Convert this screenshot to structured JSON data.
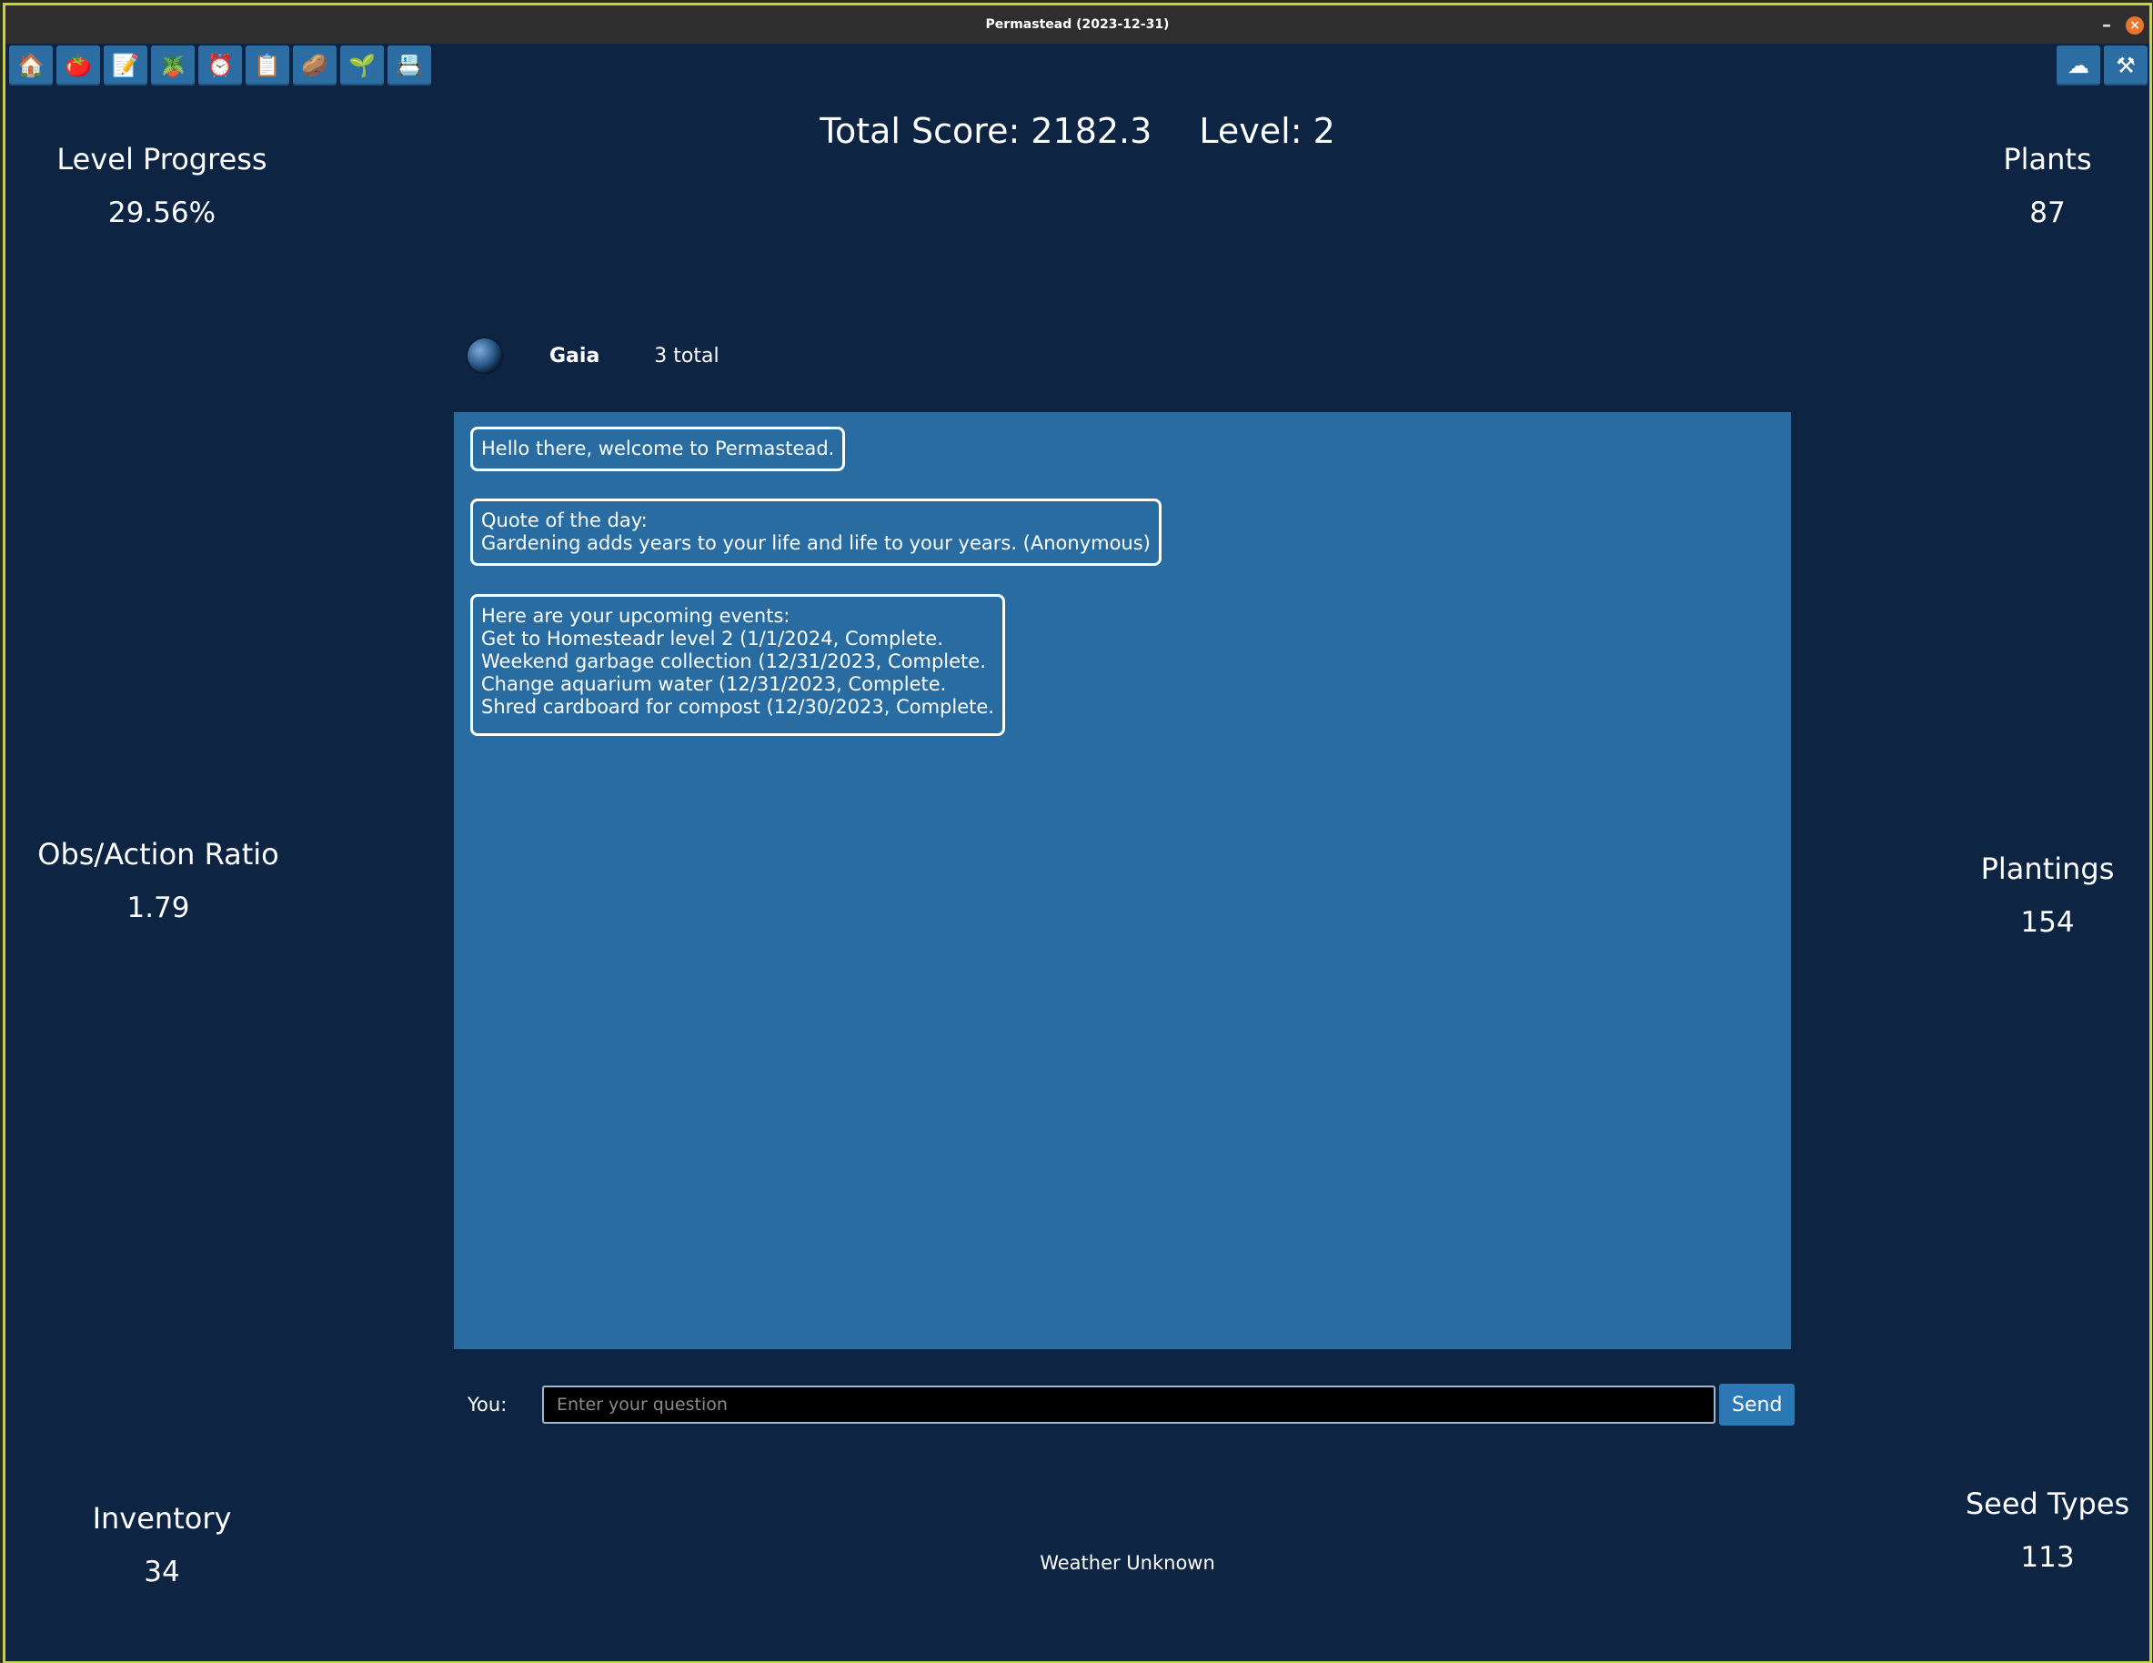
{
  "window": {
    "title": "Permastead (2023-12-31)",
    "minimize_glyph": "–",
    "close_glyph": "×"
  },
  "toolbar": {
    "left_icons": [
      {
        "name": "home-icon",
        "glyph": "🏠"
      },
      {
        "name": "tomato-icon",
        "glyph": "🍅"
      },
      {
        "name": "notepad-icon",
        "glyph": "📝"
      },
      {
        "name": "shovel-icon",
        "glyph": "🪴"
      },
      {
        "name": "alarm-clock-icon",
        "glyph": "⏰"
      },
      {
        "name": "clipboard-icon",
        "glyph": "📋"
      },
      {
        "name": "seed-icon",
        "glyph": "🥔"
      },
      {
        "name": "sprout-icon",
        "glyph": "🌱"
      },
      {
        "name": "id-card-icon",
        "glyph": "📇"
      }
    ],
    "right_icons": [
      {
        "name": "cloud-icon",
        "glyph": "☁"
      },
      {
        "name": "tools-icon",
        "glyph": "⚒"
      }
    ]
  },
  "score": {
    "total": "Total Score: 2182.3",
    "level": "Level: 2"
  },
  "stats": {
    "level_progress": {
      "label": "Level Progress",
      "value": "29.56%"
    },
    "plants": {
      "label": "Plants",
      "value": "87"
    },
    "obs_action": {
      "label": "Obs/Action Ratio",
      "value": "1.79"
    },
    "plantings": {
      "label": "Plantings",
      "value": "154"
    },
    "inventory": {
      "label": "Inventory",
      "value": "34"
    },
    "seed_types": {
      "label": "Seed Types",
      "value": "113"
    }
  },
  "chat": {
    "agent_name": "Gaia",
    "total": "3 total",
    "messages": [
      "Hello there, welcome to Permastead.",
      "Quote of the day:\nGardening adds years to your life and life to your years. (Anonymous)",
      "Here are your upcoming events:\nGet to Homesteadr level 2 (1/1/2024, Complete.\nWeekend garbage collection (12/31/2023, Complete.\nChange aquarium water (12/31/2023, Complete.\nShred cardboard for compost (12/30/2023, Complete.\n"
    ]
  },
  "input": {
    "label": "You:",
    "placeholder": "Enter your question",
    "value": "",
    "send_label": "Send"
  },
  "weather": "Weather Unknown"
}
